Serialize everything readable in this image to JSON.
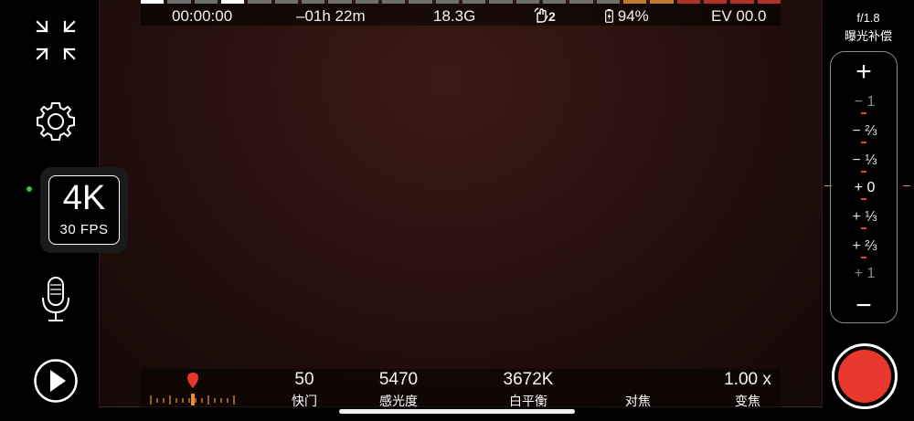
{
  "top_status": {
    "timecode": "00:00:00",
    "remaining": "–01h 22m",
    "storage": "18.3G",
    "stabilization_count": "2",
    "battery": "94%",
    "ev": "EV 00.0"
  },
  "resolution": {
    "main": "4K",
    "fps": "30 FPS"
  },
  "bottom_stats": [
    {
      "key": "shutter",
      "value": "50",
      "label": "快门"
    },
    {
      "key": "iso",
      "value": "5470",
      "label": "感光度"
    },
    {
      "key": "wb",
      "value": "3672K",
      "label": "白平衡"
    },
    {
      "key": "focus",
      "value": "",
      "label": "对焦"
    },
    {
      "key": "zoom",
      "value": "1.00 x",
      "label": "变焦"
    }
  ],
  "aperture": {
    "value": "f/1.8",
    "label": "曝光补偿"
  },
  "ev_panel": {
    "plus": "+",
    "minus": "−",
    "steps": [
      "− 1",
      "− ⅔",
      "− ⅓",
      "+ 0",
      "+ ⅓",
      "+ ⅔",
      "+ 1"
    ]
  },
  "colors": {
    "record": "#e8372c",
    "accent_orange": "#e8902b",
    "status_green": "#3bc24a"
  }
}
